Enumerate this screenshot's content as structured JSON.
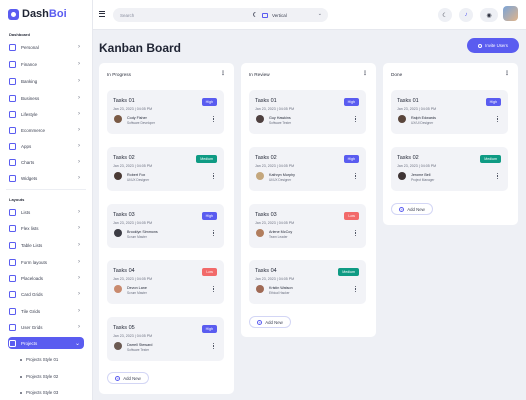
{
  "app": {
    "logo_prefix": "Dash",
    "logo_suffix": "Boi"
  },
  "sidebar": {
    "section1": "Dashboard",
    "items1": [
      {
        "label": "Personal"
      },
      {
        "label": "Finance"
      },
      {
        "label": "Banking"
      },
      {
        "label": "Business"
      },
      {
        "label": "Lifestyle"
      },
      {
        "label": "Ecommerce"
      },
      {
        "label": "Apps"
      },
      {
        "label": "Charts"
      },
      {
        "label": "Widgets"
      }
    ],
    "section2": "Layouts",
    "items2": [
      {
        "label": "Lists"
      },
      {
        "label": "Flex lists"
      },
      {
        "label": "Table Lists"
      },
      {
        "label": "Form layouts"
      },
      {
        "label": "Placeloads"
      },
      {
        "label": "Card Grids"
      },
      {
        "label": "Tile Grids"
      },
      {
        "label": "User Grids"
      },
      {
        "label": "Projects"
      }
    ],
    "sub_items": [
      {
        "label": "Projects Style 01"
      },
      {
        "label": "Projects Style 02"
      },
      {
        "label": "Projects Style 03"
      }
    ]
  },
  "topbar": {
    "search_placeholder": "Search",
    "layout_value": "Vertical"
  },
  "main": {
    "title": "Kanban Board",
    "invite_label": "Invite Users",
    "add_label": "Add New",
    "columns": [
      {
        "title": "In Progress",
        "cards": [
          {
            "title": "Tasks 01",
            "date": "Jan 23, 2023 | 04:05 PM",
            "priority": "High",
            "name": "Cody Fisher",
            "role": "Software Developer"
          },
          {
            "title": "Tasks 02",
            "date": "Jan 23, 2023 | 04:05 PM",
            "priority": "Medium",
            "name": "Robert Fox",
            "role": "UI/UX Designer"
          },
          {
            "title": "Tasks 03",
            "date": "Jan 23, 2023 | 04:05 PM",
            "priority": "High",
            "name": "Brooklyn Simmons",
            "role": "Scrum Master"
          },
          {
            "title": "Tasks 04",
            "date": "Jan 23, 2023 | 04:05 PM",
            "priority": "Low",
            "name": "Devon Lane",
            "role": "Scrum Master"
          },
          {
            "title": "Tasks 05",
            "date": "Jan 23, 2023 | 04:05 PM",
            "priority": "High",
            "name": "Darrell Steward",
            "role": "Software Tester"
          }
        ]
      },
      {
        "title": "In Review",
        "cards": [
          {
            "title": "Tasks 01",
            "date": "Jan 23, 2023 | 04:05 PM",
            "priority": "High",
            "name": "Guy Hawkins",
            "role": "Software Tester"
          },
          {
            "title": "Tasks 02",
            "date": "Jan 23, 2023 | 04:05 PM",
            "priority": "High",
            "name": "Kathryn Murphy",
            "role": "UI/UX Designer"
          },
          {
            "title": "Tasks 03",
            "date": "Jan 23, 2023 | 04:05 PM",
            "priority": "Low",
            "name": "Arlene McCoy",
            "role": "Team Leader"
          },
          {
            "title": "Tasks 04",
            "date": "Jan 23, 2023 | 04:05 PM",
            "priority": "Medium",
            "name": "Kristin Watson",
            "role": "Ethical Hacker"
          }
        ]
      },
      {
        "title": "Done",
        "cards": [
          {
            "title": "Tasks 01",
            "date": "Jan 23, 2023 | 04:05 PM",
            "priority": "High",
            "name": "Ralph Edwards",
            "role": "UX/UI Designer"
          },
          {
            "title": "Tasks 02",
            "date": "Jan 23, 2023 | 04:05 PM",
            "priority": "Medium",
            "name": "Jerome Bell",
            "role": "Project Manager"
          }
        ]
      }
    ]
  }
}
